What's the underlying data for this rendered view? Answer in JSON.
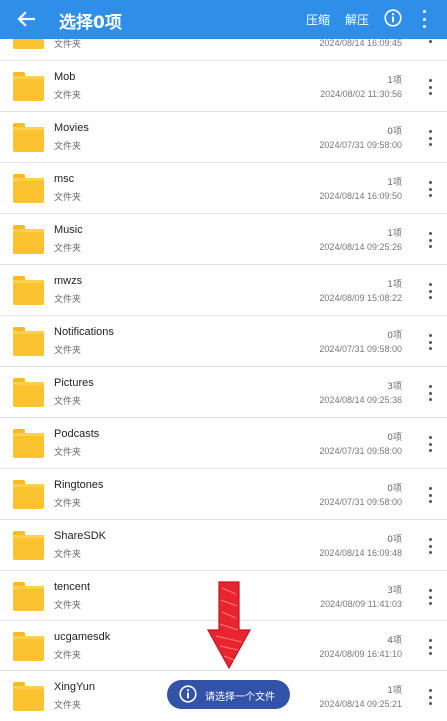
{
  "header": {
    "title": "选择0项",
    "compress": "压缩",
    "extract": "解压",
    "back_icon": "arrow-left-icon",
    "info_icon": "info-icon",
    "more_icon": "more-vertical-icon"
  },
  "files": [
    {
      "name": "",
      "type": "文件夹",
      "count": "",
      "date": "2024/08/14 16:09:45"
    },
    {
      "name": "Mob",
      "type": "文件夹",
      "count": "1项",
      "date": "2024/08/02 11:30:56"
    },
    {
      "name": "Movies",
      "type": "文件夹",
      "count": "0项",
      "date": "2024/07/31 09:58:00"
    },
    {
      "name": "msc",
      "type": "文件夹",
      "count": "1项",
      "date": "2024/08/14 16:09:50"
    },
    {
      "name": "Music",
      "type": "文件夹",
      "count": "1项",
      "date": "2024/08/14 09:25:26"
    },
    {
      "name": "mwzs",
      "type": "文件夹",
      "count": "1项",
      "date": "2024/08/09 15:08:22"
    },
    {
      "name": "Notifications",
      "type": "文件夹",
      "count": "0项",
      "date": "2024/07/31 09:58:00"
    },
    {
      "name": "Pictures",
      "type": "文件夹",
      "count": "3项",
      "date": "2024/08/14 09:25:36"
    },
    {
      "name": "Podcasts",
      "type": "文件夹",
      "count": "0项",
      "date": "2024/07/31 09:58:00"
    },
    {
      "name": "Ringtones",
      "type": "文件夹",
      "count": "0项",
      "date": "2024/07/31 09:58:00"
    },
    {
      "name": "ShareSDK",
      "type": "文件夹",
      "count": "0项",
      "date": "2024/08/14 16:09:48"
    },
    {
      "name": "tencent",
      "type": "文件夹",
      "count": "3项",
      "date": "2024/08/09 11:41:03"
    },
    {
      "name": "ucgamesdk",
      "type": "文件夹",
      "count": "4项",
      "date": "2024/08/09 16:41:10"
    },
    {
      "name": "XingYun",
      "type": "文件夹",
      "count": "1项",
      "date": "2024/08/14 09:25:21"
    }
  ],
  "toast": {
    "text": "请选择一个文件",
    "icon": "info-icon"
  },
  "colors": {
    "appbar": "#2f8ee8",
    "folder": "#fbc230",
    "toast": "#3353a8",
    "arrow": "#e8252f"
  }
}
